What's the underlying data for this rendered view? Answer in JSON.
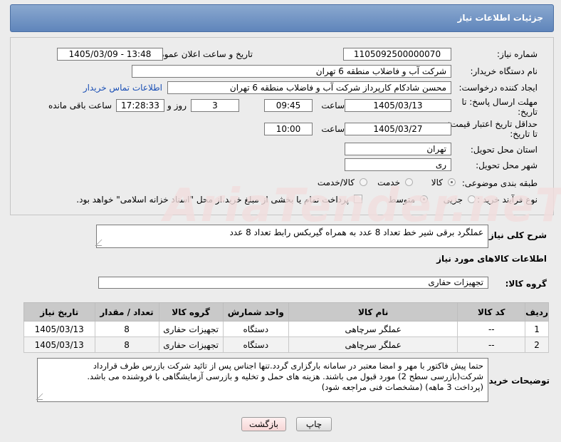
{
  "header": {
    "title": "جزئیات اطلاعات نیاز"
  },
  "form": {
    "need_number": {
      "label": "شماره نیاز:",
      "value": "1105092500000070"
    },
    "announce_datetime": {
      "label": "تاریخ و ساعت اعلان عمومی:",
      "value": "1405/03/09 - 13:48"
    },
    "buyer_org": {
      "label": "نام دستگاه خریدار:",
      "value": "شرکت آب و فاضلاب منطقه 6 تهران"
    },
    "requester": {
      "label": "ایجاد کننده درخواست:",
      "value": "محسن شادکام کارپرداز شرکت آب و فاضلاب منطقه 6 تهران",
      "contact_link": "اطلاعات تماس خریدار"
    },
    "reply_deadline": {
      "label_line1": "مهلت ارسال پاسخ: تا",
      "label_line2": "تاریخ:",
      "date": "1405/03/13",
      "time_label": "ساعت",
      "time": "09:45",
      "days": "3",
      "days_label": "روز و",
      "remaining": "17:28:33",
      "remaining_label": "ساعت باقی مانده"
    },
    "price_validity": {
      "label_line1": "حداقل تاریخ اعتبار قیمت:",
      "label_line2": "تا تاریخ:",
      "date": "1405/03/27",
      "time_label": "ساعت",
      "time": "10:00"
    },
    "province": {
      "label": "استان محل تحویل:",
      "value": "تهران"
    },
    "city": {
      "label": "شهر محل تحویل:",
      "value": "ری"
    },
    "category": {
      "label": "طبقه بندی موضوعی:",
      "options": [
        "کالا",
        "خدمت",
        "کالا/خدمت"
      ],
      "selected": "کالا"
    },
    "process_type": {
      "label": "نوع فرآیند خرید :",
      "options": [
        "جزیی",
        "متوسط"
      ],
      "selected": "متوسط",
      "payment_note": "پرداخت تمام یا بخشی از مبلغ خرید،از محل \"اسناد خزانه اسلامی\" خواهد بود."
    }
  },
  "watermark": "AriaTender.neT",
  "description": {
    "label": "شرح کلی نیاز:",
    "value": "عملگرد برقی شیر خط تعداد 8 عدد به همراه گیربکس رابط تعداد 8 عدد"
  },
  "goods_info": {
    "title": "اطلاعات کالاهای مورد نیاز",
    "group_label": "گروه کالا:",
    "group_value": "تجهیزات حفاری",
    "columns": [
      "ردیف",
      "کد کالا",
      "نام کالا",
      "واحد شمارش",
      "گروه کالا",
      "تعداد / مقدار",
      "تاریخ نیاز"
    ],
    "rows": [
      [
        "1",
        "--",
        "عملگر سرچاهی",
        "دستگاه",
        "تجهیزات حفاری",
        "8",
        "1405/03/13"
      ],
      [
        "2",
        "--",
        "عملگر سرچاهی",
        "دستگاه",
        "تجهیزات حفاری",
        "8",
        "1405/03/13"
      ]
    ]
  },
  "buyer_notes": {
    "label": "توضیحات خریدار:",
    "lines": [
      "حتما پیش فاکتور با مهر و امضا معتبر در سامانه بارگزاری گردد.تنها اجناس پس از تائید شرکت بازرس طرف قرارداد",
      "شرکت(بازرسی سطح 2) مورد قبول می باشند. هزینه های حمل و تخلیه و بازرسی آزمایشگاهی با فروشنده می باشد.",
      "(پرداخت 3 ماهه) (مشخصات فنی مراجعه شود)"
    ]
  },
  "buttons": {
    "print": "چاپ",
    "back": "بازگشت"
  }
}
